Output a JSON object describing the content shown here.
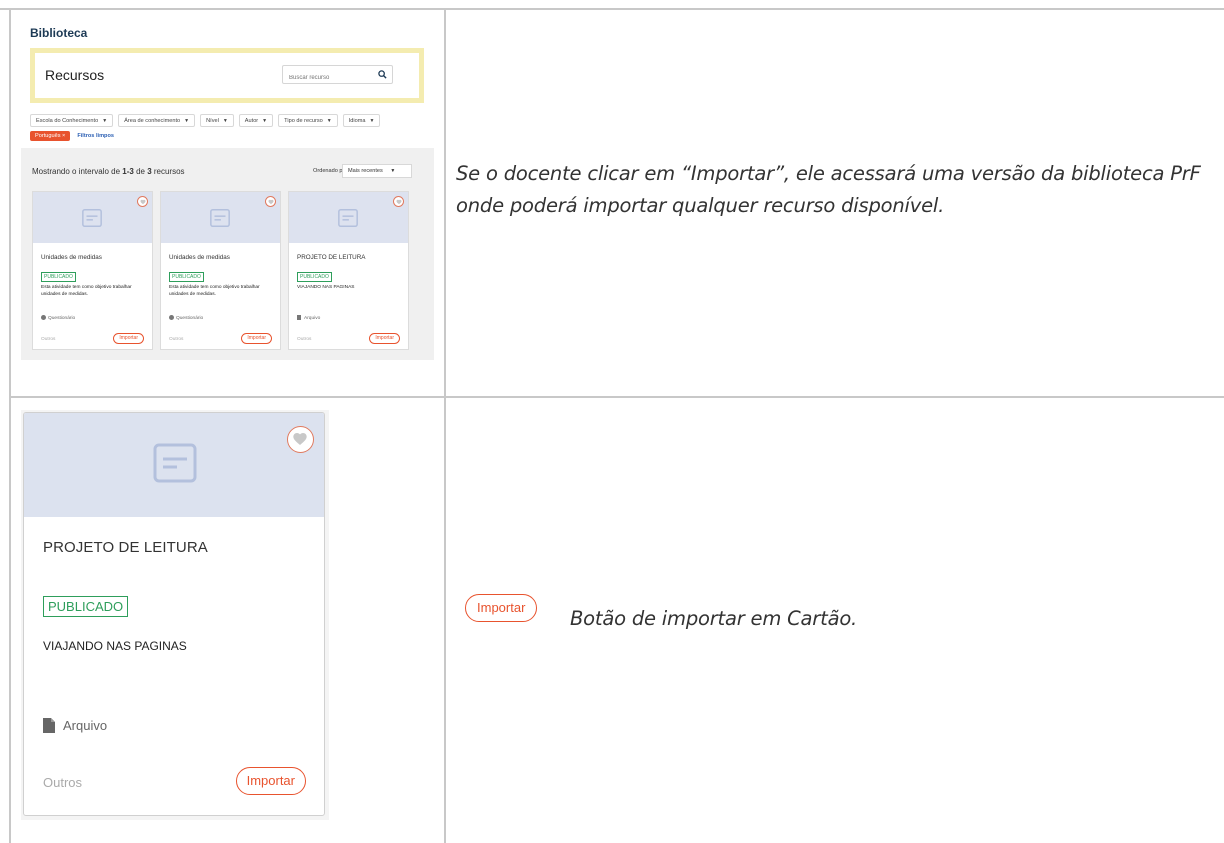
{
  "library": {
    "title": "Biblioteca",
    "section_title": "Recursos",
    "search_placeholder": "Buscar recurso",
    "filters": [
      {
        "label": "Escola do Conhecimento"
      },
      {
        "label": "Área de conhecimento"
      },
      {
        "label": "Nível"
      },
      {
        "label": "Autor"
      },
      {
        "label": "Tipo de recurso"
      },
      {
        "label": "Idioma"
      }
    ],
    "active_filter": "Português",
    "clear_filters": "Filtros limpos",
    "results_text": "Mostrando o intervalo de 1-3 de 3 recursos",
    "sort_label": "Ordenado por",
    "sort_value": "Mais recentes",
    "cards": [
      {
        "title": "Unidades de medidas",
        "status": "PUBLICADO",
        "description": "Esta atividade tem como objetivo trabalhar unidades de medidas.",
        "type": "Questionário",
        "category": "Outros",
        "action": "Importar"
      },
      {
        "title": "Unidades de medidas",
        "status": "PUBLICADO",
        "description": "Esta atividade tem como objetivo trabalhar unidades de medidas.",
        "type": "Questionário",
        "category": "Outros",
        "action": "Importar"
      },
      {
        "title": "PROJETO DE LEITURA",
        "status": "PUBLICADO",
        "description": "VIAJANDO NAS PAGINAS",
        "type": "Arquivo",
        "category": "Outros",
        "action": "Importar"
      }
    ]
  },
  "description_top": "Se o docente clicar em “Importar”, ele acessará uma versão da biblioteca PrF onde poderá importar qualquer recurso disponível.",
  "import_button_demo": "Importar",
  "description_bottom": "Botão de importar em Cartão.",
  "big_card": {
    "title": "PROJETO DE LEITURA",
    "status": "PUBLICADO",
    "description": "VIAJANDO NAS PAGINAS",
    "type": "Arquivo",
    "category": "Outros",
    "action": "Importar"
  },
  "colors": {
    "accent": "#e8532e",
    "published": "#2e9e5b",
    "highlight": "#f4ecb0",
    "thumb_bg": "#dce2ef"
  },
  "icons": {
    "search": "search-icon",
    "heart": "heart-icon",
    "document": "document-icon",
    "file": "file-icon",
    "quiz": "question-icon",
    "caret": "caret-down-icon"
  }
}
